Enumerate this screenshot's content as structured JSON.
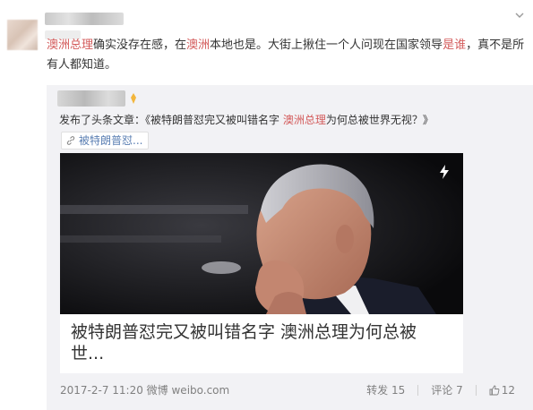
{
  "post": {
    "text_parts": [
      {
        "t": "澳洲总理",
        "hl": true
      },
      {
        "t": "确实没存在感，在",
        "hl": false
      },
      {
        "t": "澳洲",
        "hl": true
      },
      {
        "t": "本地也是。大街上揪住一个人问现在国家领导",
        "hl": false
      },
      {
        "t": "是谁",
        "hl": true
      },
      {
        "t": "，真不是所有人都知道。",
        "hl": false
      }
    ]
  },
  "repost": {
    "prefix": "发布了头条文章：《被特朗普怼完又被叫错名字 ",
    "highlight": "澳洲总理",
    "suffix": "为何总被世界无视？》",
    "tag_label": "被特朗普怼...",
    "caption": "被特朗普怼完又被叫错名字 澳洲总理为何总被世...",
    "meta": "2017-2-7 11:20 微博 weibo.com",
    "repost_label": "转发 15",
    "comment_label": "评论 7",
    "like_count": "12"
  },
  "colors": {
    "highlight": "#d35a5a",
    "link": "#5b7fb3",
    "card_bg": "#f2f2f5"
  },
  "icons": [
    "chevron-down-icon",
    "link-icon",
    "flash-icon",
    "like-icon",
    "vip-badge-icon"
  ]
}
